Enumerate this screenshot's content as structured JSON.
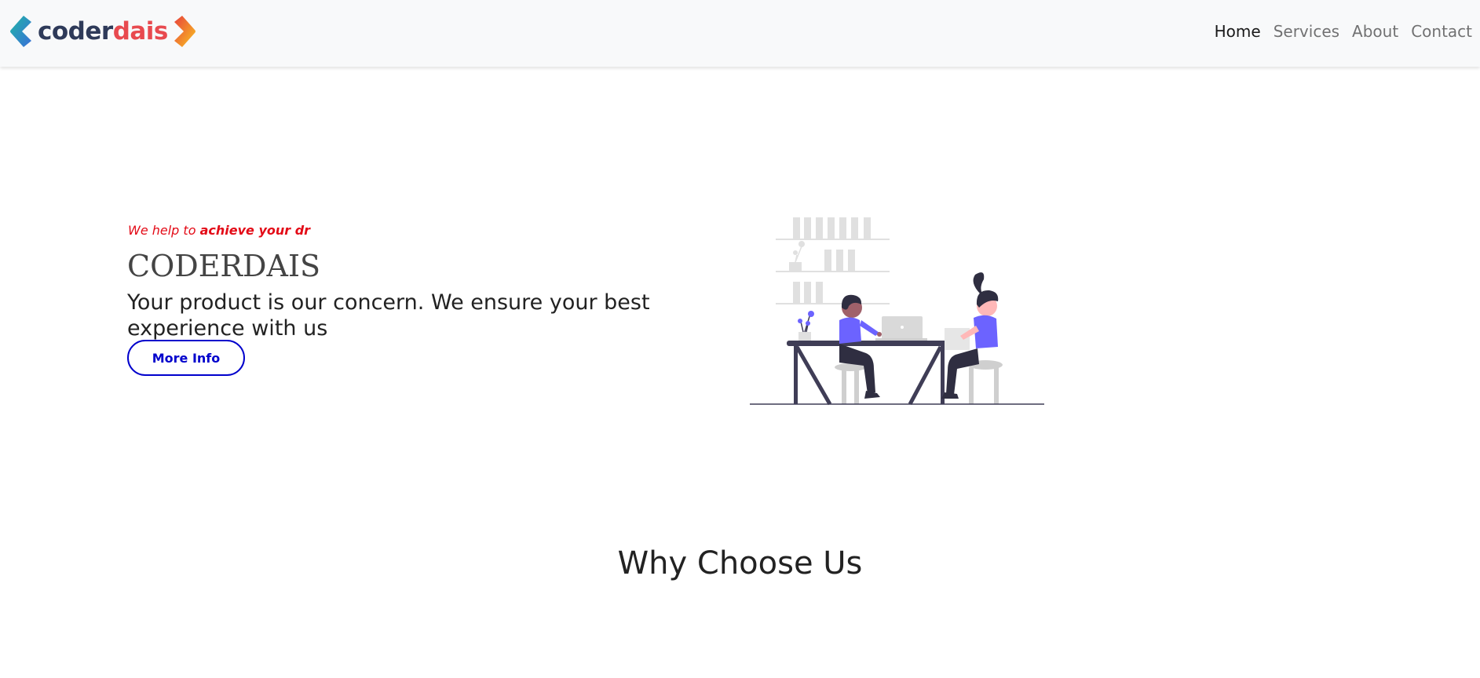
{
  "brand": {
    "part1": "coder",
    "part2": "dais",
    "colors": {
      "dark": "#2e3a59",
      "red": "#e84a4f"
    }
  },
  "nav": {
    "items": [
      {
        "label": "Home",
        "active": true
      },
      {
        "label": "Services",
        "active": false
      },
      {
        "label": "About",
        "active": false
      },
      {
        "label": "Contact",
        "active": false
      }
    ]
  },
  "hero": {
    "tagline_prefix": "We help to",
    "tagline_emphasis": "achieve your dr",
    "title": "CODERDAIS",
    "description": "Your product is our concern. We ensure your best experience with us",
    "button_label": "More Info",
    "illustration_icon": "team-meeting-illustration"
  },
  "section": {
    "title": "Why Choose Us"
  },
  "colors": {
    "accent_red": "#e30b17",
    "button_blue": "#0000cc",
    "illustration_purple": "#6c63ff"
  }
}
